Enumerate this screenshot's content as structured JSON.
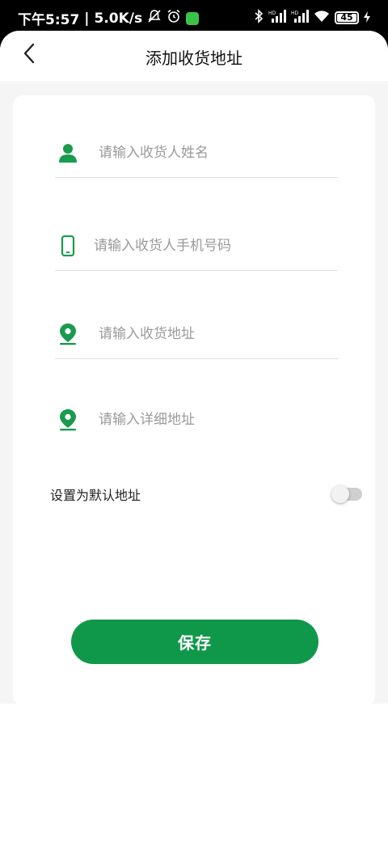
{
  "status_bar": {
    "time": "下午5:57",
    "speed": "5.0K/s",
    "battery": "45"
  },
  "header": {
    "title": "添加收货地址"
  },
  "form": {
    "name_placeholder": "请输入收货人姓名",
    "phone_placeholder": "请输入收货人手机号码",
    "address_placeholder": "请输入收货地址",
    "detail_placeholder": "请输入详细地址",
    "default_label": "设置为默认地址",
    "default_enabled": false
  },
  "actions": {
    "save_label": "保存"
  },
  "colors": {
    "accent": "#10984a",
    "icon_green": "#1a9a4e"
  },
  "icons": [
    "back-arrow-icon",
    "person-icon",
    "phone-icon",
    "location-pin-icon"
  ]
}
